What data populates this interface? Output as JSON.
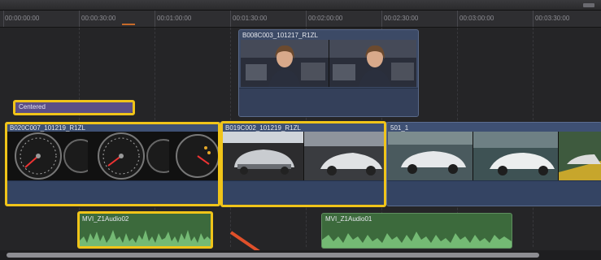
{
  "ruler": {
    "ticks": [
      "00:00:00:00",
      "00:00:30:00",
      "00:01:00:00",
      "00:01:30:00",
      "00:02:00:00",
      "00:02:30:00",
      "00:03:00:00",
      "00:03:30:00"
    ]
  },
  "connected_clip": {
    "name": "B008C003_101217_R1ZL"
  },
  "title_clip": {
    "name": "Centered"
  },
  "storyline": {
    "clips": [
      {
        "name": "B020C007_101219_R1ZL"
      },
      {
        "name": "B019C002_101219_R1ZL"
      },
      {
        "name": "501_1"
      }
    ]
  },
  "audio_clips": [
    {
      "name": "MVI_Z1Audio02"
    },
    {
      "name": "MVI_Z1Audio01"
    }
  ],
  "colors": {
    "highlight": "#f0c419",
    "video_clip": "#3e5073",
    "audio_clip": "#3c6a3c",
    "title_clip": "#5b4e86",
    "annotation_arrow": "#e0502a"
  },
  "icons": [
    "drag-grip-icon",
    "annotation-arrow"
  ]
}
